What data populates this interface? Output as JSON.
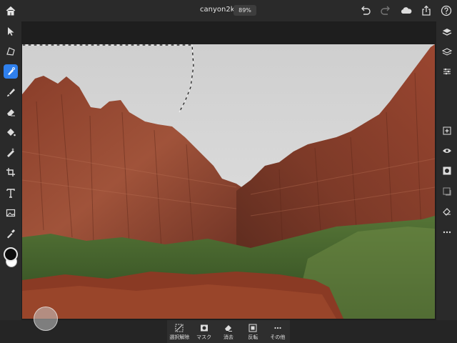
{
  "document": {
    "title": "canyon2k",
    "zoom": "89%"
  },
  "header": {
    "home_icon": "home-icon",
    "undo_icon": "undo-icon",
    "redo_icon": "redo-icon",
    "cloud_icon": "cloud-icon",
    "share_icon": "share-icon",
    "help_icon": "help-icon"
  },
  "left_toolbar": {
    "tools": [
      "select",
      "transform",
      "quick-select",
      "brush",
      "eraser",
      "fill",
      "healing",
      "crop",
      "text",
      "image",
      "eyedropper",
      "color"
    ],
    "active_tool": "quick-select"
  },
  "tool_options": {
    "brush_size": "30"
  },
  "right_toolbar": {
    "tools": [
      "layers",
      "layer-properties",
      "adjustments",
      "add-layer",
      "visibility",
      "mask",
      "fill-layer",
      "clear",
      "more"
    ]
  },
  "bottom_actions": [
    {
      "label": "選択解除",
      "icon": "deselect-icon"
    },
    {
      "label": "マスク",
      "icon": "mask-icon"
    },
    {
      "label": "消去",
      "icon": "erase-icon"
    },
    {
      "label": "反転",
      "icon": "invert-icon"
    },
    {
      "label": "その他",
      "icon": "more-icon"
    }
  ],
  "colors": {
    "accent": "#2f80ed",
    "foreground": "#0d0d0d",
    "background_color": "#ffffff"
  }
}
